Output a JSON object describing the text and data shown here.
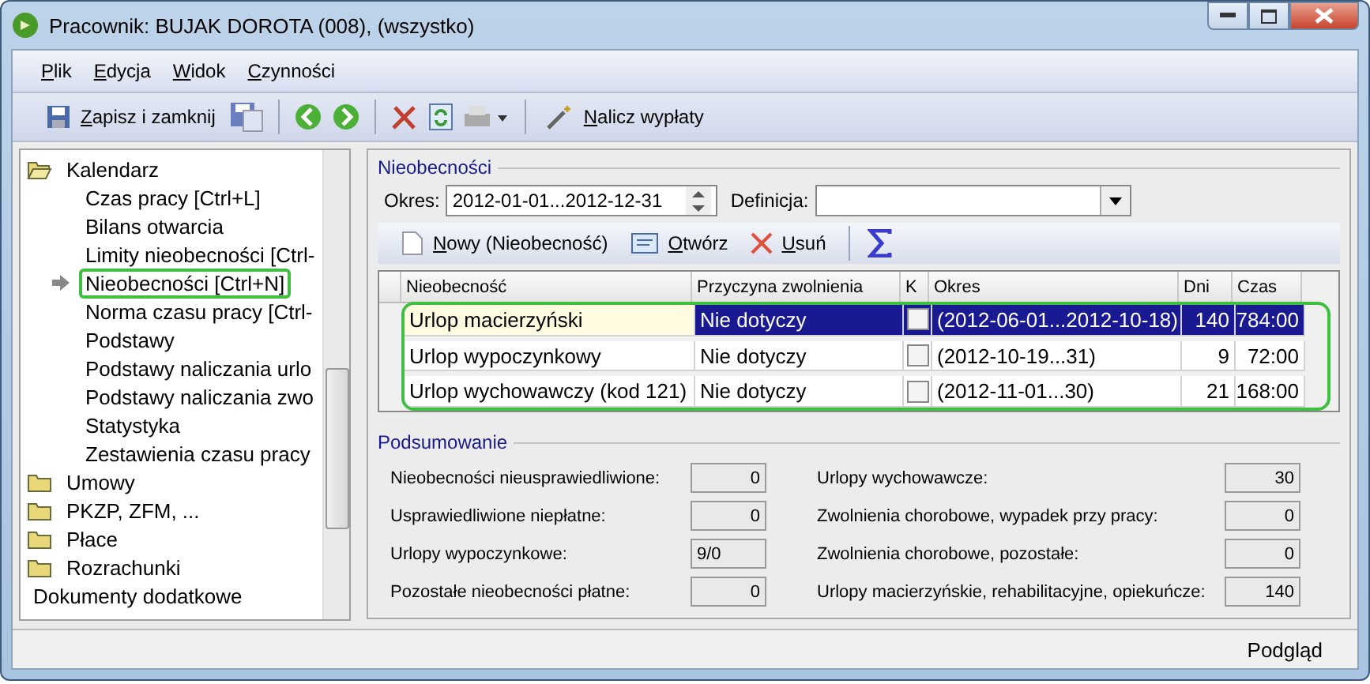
{
  "window": {
    "title": "Pracownik: BUJAK DOROTA (008), (wszystko)"
  },
  "menu": [
    "Plik",
    "Edycja",
    "Widok",
    "Czynności"
  ],
  "toolbar": {
    "save_close": "Zapisz i zamknij",
    "calculate": "Nalicz wypłaty"
  },
  "sidebar": {
    "items": [
      {
        "label": "Kalendarz",
        "kind": "folder",
        "expanded": true,
        "children": [
          {
            "label": "Czas pracy [Ctrl+L]",
            "selected": false
          },
          {
            "label": "Bilans otwarcia",
            "selected": false
          },
          {
            "label": "Limity nieobecności [Ctrl-",
            "selected": false
          },
          {
            "label": "Nieobecności [Ctrl+N]",
            "selected": true
          },
          {
            "label": "Norma czasu pracy [Ctrl-",
            "selected": false
          },
          {
            "label": "Podstawy",
            "selected": false
          },
          {
            "label": "Podstawy naliczania urlo",
            "selected": false
          },
          {
            "label": "Podstawy naliczania zwo",
            "selected": false
          },
          {
            "label": "Statystyka",
            "selected": false
          },
          {
            "label": "Zestawienia czasu pracy",
            "selected": false
          }
        ]
      },
      {
        "label": "Umowy",
        "kind": "folder",
        "expanded": false
      },
      {
        "label": "PKZP, ZFM, ...",
        "kind": "folder",
        "expanded": false
      },
      {
        "label": "Płace",
        "kind": "folder",
        "expanded": false
      },
      {
        "label": "Rozrachunki",
        "kind": "folder",
        "expanded": false
      },
      {
        "label": "Dokumenty dodatkowe",
        "kind": "item"
      }
    ]
  },
  "absences": {
    "legend": "Nieobecności",
    "period_label": "Okres:",
    "period_value": "2012-01-01...2012-12-31",
    "definition_label": "Definicja:",
    "actions": [
      "Nowy (Nieobecność)",
      "Otwórz",
      "Usuń"
    ],
    "columns": [
      "Nieobecność",
      "Przyczyna zwolnienia",
      "K",
      "Okres",
      "Dni",
      "Czas"
    ],
    "rows": [
      {
        "name": "Urlop macierzyński",
        "reason": "Nie dotyczy",
        "k_checked": false,
        "period": "(2012-06-01...2012-10-18)",
        "days": "140",
        "time": "784:00",
        "selected": true
      },
      {
        "name": "Urlop wypoczynkowy",
        "reason": "Nie dotyczy",
        "k_checked": false,
        "period": "(2012-10-19...31)",
        "days": "9",
        "time": "72:00",
        "selected": false
      },
      {
        "name": "Urlop wychowawczy (kod 121)",
        "reason": "Nie dotyczy",
        "k_checked": false,
        "period": "(2012-11-01...30)",
        "days": "21",
        "time": "168:00",
        "selected": false
      }
    ]
  },
  "summary": {
    "legend": "Podsumowanie",
    "left": [
      {
        "label": "Nieobecności nieusprawiedliwione:",
        "value": "0"
      },
      {
        "label": "Usprawiedliwione niepłatne:",
        "value": "0"
      },
      {
        "label": "Urlopy wypoczynkowe:",
        "value": "9/0"
      },
      {
        "label": "Pozostałe nieobecności płatne:",
        "value": "0"
      }
    ],
    "right": [
      {
        "label": "Urlopy wychowawcze:",
        "value": "30"
      },
      {
        "label": "Zwolnienia chorobowe, wypadek przy pracy:",
        "value": "0"
      },
      {
        "label": "Zwolnienia chorobowe, pozostałe:",
        "value": "0"
      },
      {
        "label": "Urlopy macierzyńskie, rehabilitacyjne, opiekuńcze:",
        "value": "140"
      }
    ]
  },
  "status_bar": {
    "text": "Podgląd"
  }
}
